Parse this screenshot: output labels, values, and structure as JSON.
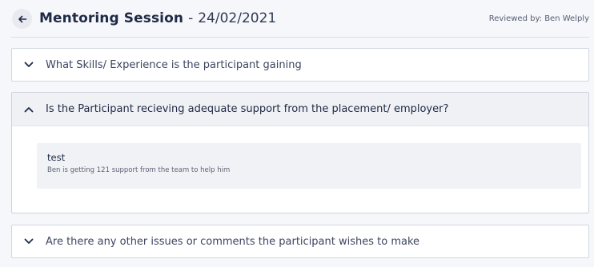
{
  "header": {
    "back_icon": "arrow-left-icon",
    "title": "Mentoring Session",
    "separator": "-",
    "date": "24/02/2021",
    "reviewed_by": "Reviewed by: Ben Welply"
  },
  "sections": [
    {
      "question": "What Skills/ Experience is the participant gaining",
      "expanded": false,
      "icon": "chevron-down-icon"
    },
    {
      "question": "Is the Participant recieving adequate support from the placement/ employer?",
      "expanded": true,
      "icon": "chevron-up-icon",
      "answer": {
        "title": "test",
        "body": "Ben is getting 121 support from the team to help him"
      }
    },
    {
      "question": "Are there any other issues or comments the participant wishes to make",
      "expanded": false,
      "icon": "chevron-down-icon"
    }
  ],
  "colors": {
    "background": "#f6f7fb",
    "text_primary": "#1f2a44",
    "expanded_header": "#eff1f5",
    "answer_box": "#f1f2f5"
  }
}
